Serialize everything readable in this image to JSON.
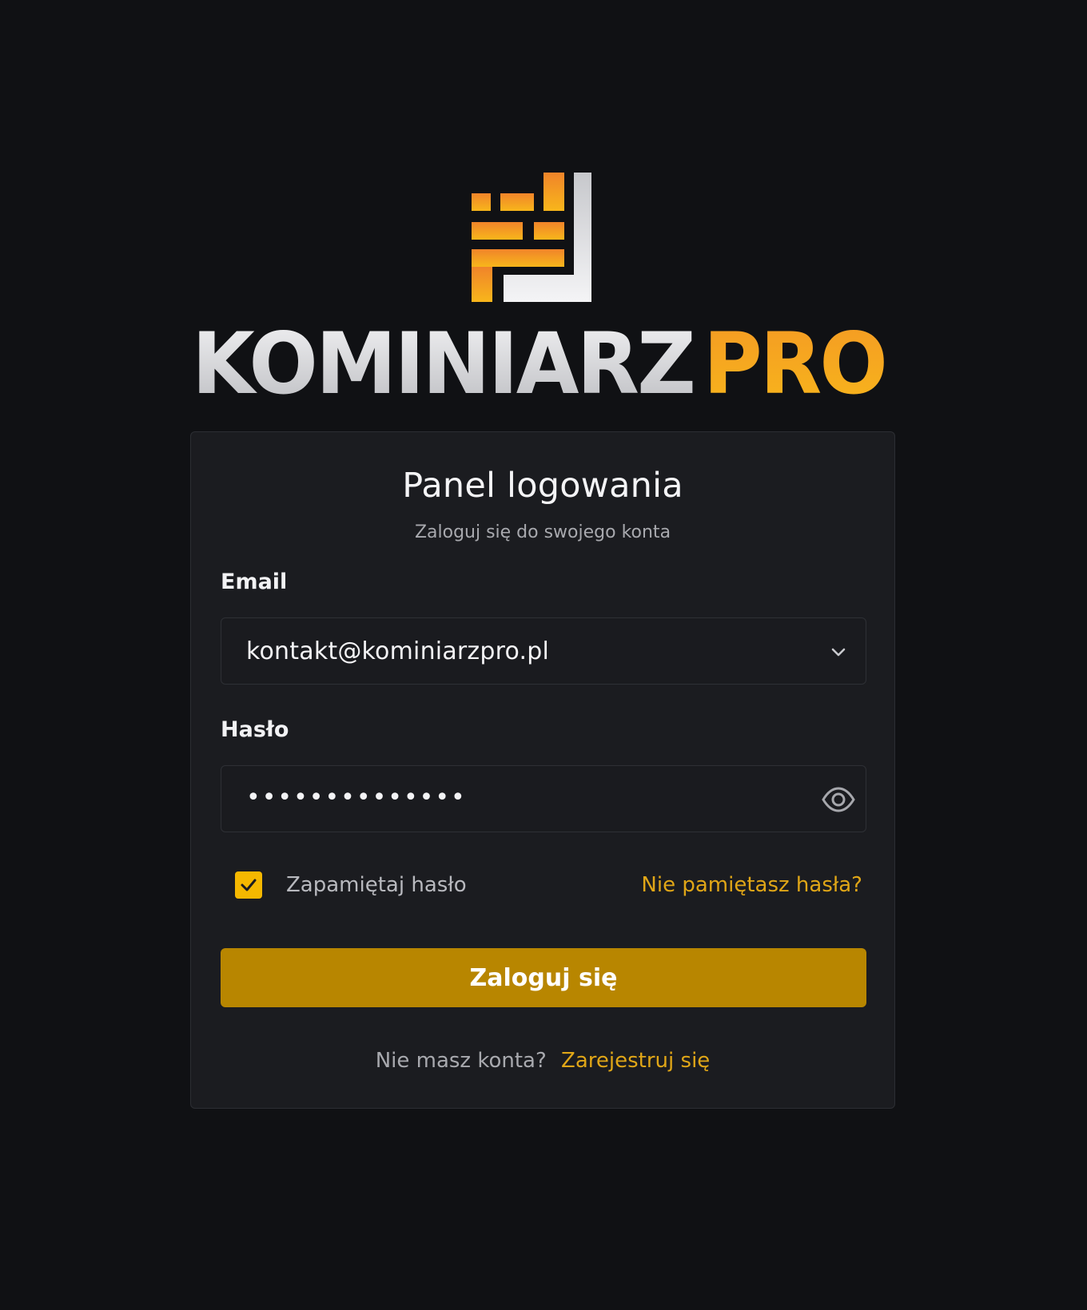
{
  "brand": {
    "name_part1": "KOMINIARZ",
    "name_part2": "PRO",
    "accent_color": "#f5a31a"
  },
  "login": {
    "title": "Panel logowania",
    "subtitle": "Zaloguj się do swojego konta",
    "email": {
      "label": "Email",
      "value": "kontakt@kominiarzpro.pl",
      "icon": "chevron-down-icon"
    },
    "password": {
      "label": "Hasło",
      "masked_value": "••••••••••••••",
      "icon": "eye-icon"
    },
    "remember": {
      "label": "Zapamiętaj hasło",
      "checked": true
    },
    "forgot_label": "Nie pamiętasz hasła?",
    "submit_label": "Zaloguj się",
    "register_prompt": "Nie masz konta?",
    "register_link": "Zarejestruj się"
  },
  "colors": {
    "background": "#101114",
    "card": "#1b1c20",
    "button": "#b88600",
    "link": "#e0a617",
    "checkbox": "#f5b800"
  }
}
